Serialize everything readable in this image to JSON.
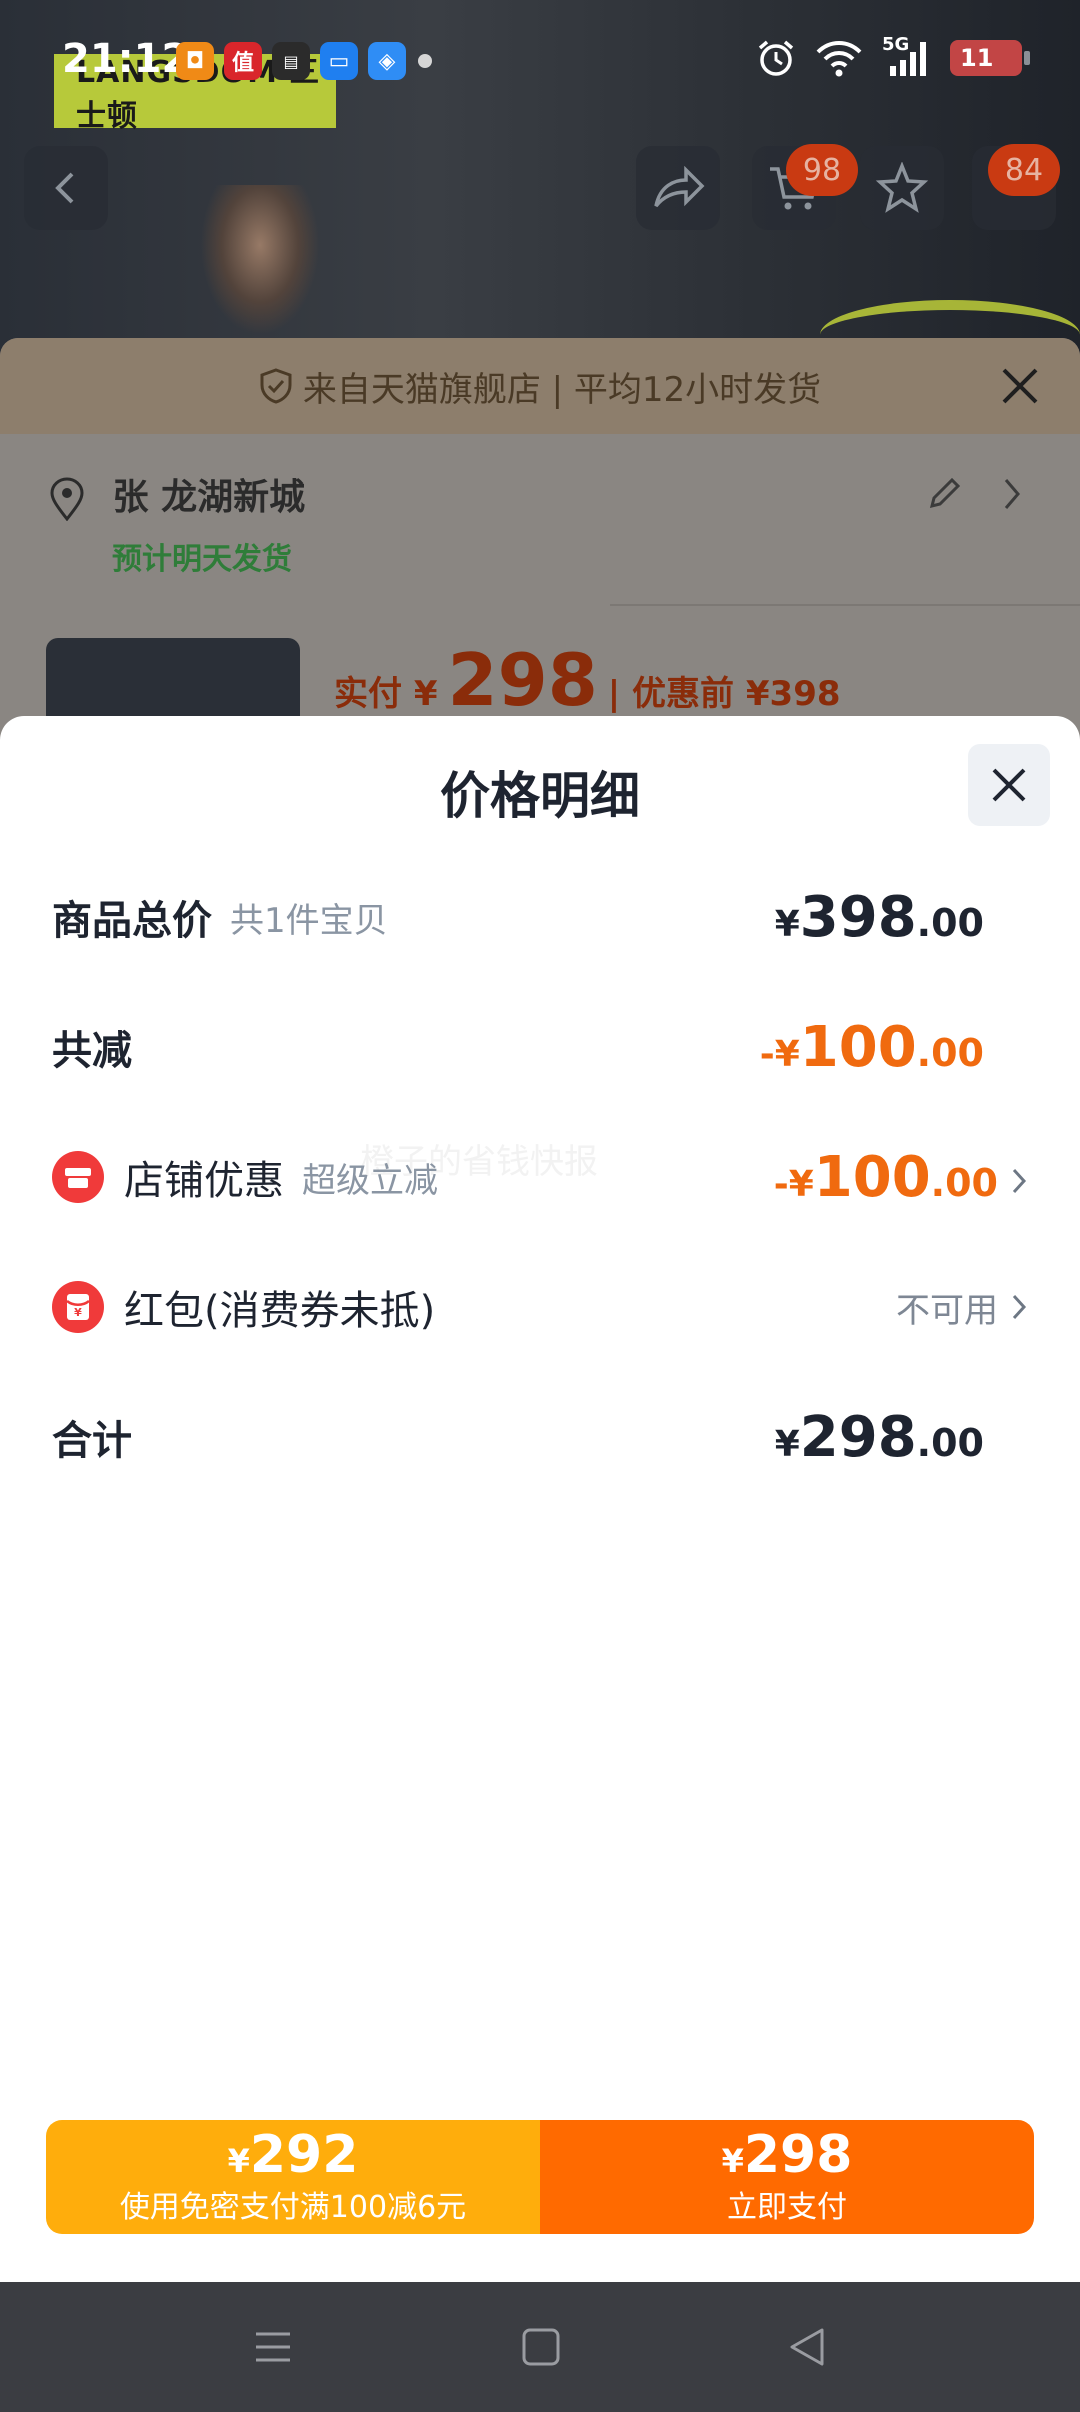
{
  "status_bar": {
    "time": "21:12",
    "battery": "11",
    "network": "5G",
    "app_icons": [
      "reader-app-icon",
      "zhi-app-icon",
      "news-app-icon",
      "files-app-icon",
      "browser-app-icon"
    ]
  },
  "background_page": {
    "brand_logo": "LANGSDOM 三士顿",
    "cart_badge": "98",
    "more_badge": "84",
    "banner_text": "来自天猫旗舰店 | 平均12小时发货",
    "address_line": "张 龙湖新城",
    "delivery_green": "预计明天发货",
    "actual_price_label": "实付 ¥",
    "actual_price_value": "298",
    "original_price_label": "| 优惠前 ¥398"
  },
  "sheet": {
    "title": "价格明细",
    "watermark": "橙子的省钱快报",
    "rows": {
      "total": {
        "label": "商品总价",
        "sub": "共1件宝贝",
        "symbol": "¥",
        "int": "398",
        "dec": ".00"
      },
      "discount_total": {
        "label": "共减",
        "symbol": "-¥",
        "int": "100",
        "dec": ".00"
      },
      "store_discount": {
        "label": "店铺优惠",
        "sub": "超级立减",
        "symbol": "-¥",
        "int": "100",
        "dec": ".00"
      },
      "red_packet": {
        "label": "红包(消费券未抵)",
        "status": "不可用"
      },
      "sum": {
        "label": "合计",
        "symbol": "¥",
        "int": "298",
        "dec": ".00"
      }
    }
  },
  "pay": {
    "left": {
      "symbol": "¥",
      "amount": "292",
      "label": "使用免密支付满100减6元"
    },
    "right": {
      "symbol": "¥",
      "amount": "298",
      "label": "立即支付"
    }
  },
  "colors": {
    "orange_accent": "#f06a0f",
    "pay_left": "#ffad0c",
    "pay_right": "#ff6a00",
    "red_icon": "#f03a3a"
  }
}
